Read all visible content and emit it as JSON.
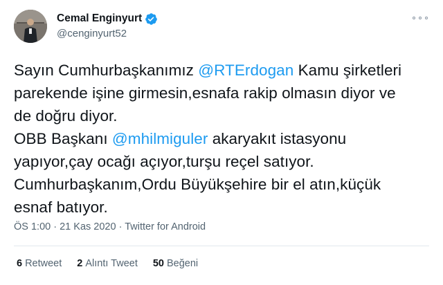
{
  "tweet": {
    "display_name": "Cemal Enginyurt",
    "handle": "@cenginyurt52",
    "more_icon": "more-horizontal-icon",
    "verified_icon": "verified-badge-icon",
    "verified_color": "#1d9bf0",
    "text_lines": [
      {
        "before": "Sayın Cumhurbaşkanımız ",
        "mention": "@RTErdogan",
        "after": " Kamu şirketleri"
      },
      {
        "before": "parekende işine girmesin,esnafa rakip olmasın diyor ve",
        "mention": "",
        "after": ""
      },
      {
        "before": "de doğru diyor.",
        "mention": "",
        "after": ""
      },
      {
        "before": "OBB Başkanı ",
        "mention": "@mhilmiguler",
        "after": " akaryakıt istasyonu"
      },
      {
        "before": "yapıyor,çay ocağı açıyor,turşu reçel satıyor.",
        "mention": "",
        "after": ""
      },
      {
        "before": "Cumhurbaşkanım,Ordu Büyükşehire bir el atın,küçük",
        "mention": "",
        "after": ""
      },
      {
        "before": "esnaf batıyor.",
        "mention": "",
        "after": ""
      }
    ],
    "time": "ÖS 1:00",
    "separator": "·",
    "date": "21 Kas 2020",
    "source": "Twitter for Android",
    "stats": {
      "retweets_count": "6",
      "retweets_label": "Retweet",
      "quotes_count": "2",
      "quotes_label": "Alıntı Tweet",
      "likes_count": "50",
      "likes_label": "Beğeni"
    },
    "colors": {
      "text": "#0f1419",
      "secondary": "#536471",
      "link": "#1d9bf0",
      "divider": "#e1e8ed"
    }
  }
}
